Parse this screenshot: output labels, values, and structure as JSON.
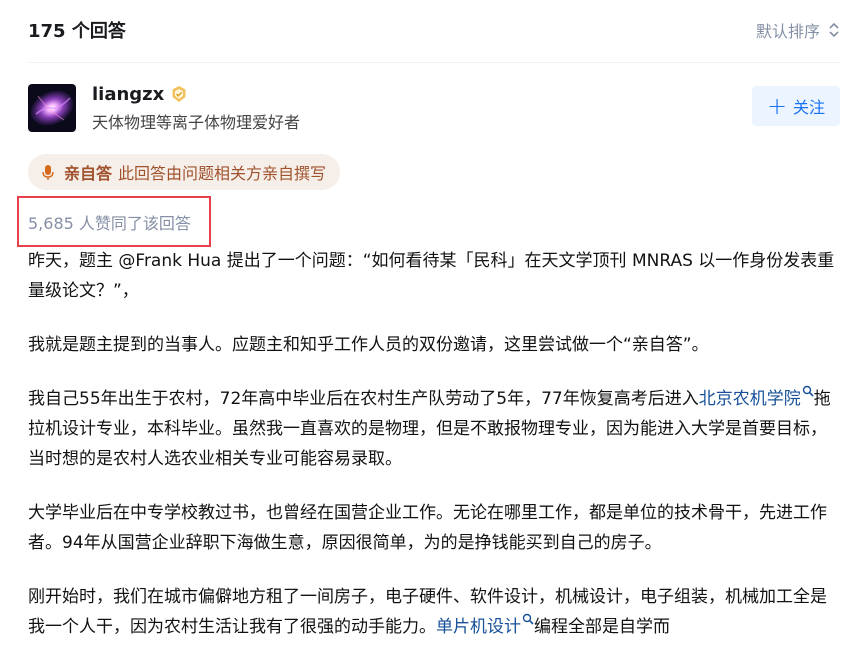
{
  "header": {
    "answer_count": "175 个回答",
    "sort_label": "默认排序"
  },
  "author": {
    "name": "liangzx",
    "bio": "天体物理等离子体物理爱好者",
    "follow_label": "关注"
  },
  "self_answer": {
    "title": "亲自答",
    "desc": "此回答由问题相关方亲自撰写"
  },
  "upvotes": {
    "text": "5,685 人赞同了该回答"
  },
  "content": {
    "p1": "昨天，题主 @Frank Hua 提出了一个问题：“如何看待某「民科」在天文学顶刊 MNRAS 以一作身份发表重量级论文？”，",
    "p2": "我就是题主提到的当事人。应题主和知乎工作人员的双份邀请，这里尝试做一个“亲自答”。",
    "p3_a": "我自己55年出生于农村，72年高中毕业后在农村生产队劳动了5年，77年恢复高考后进入",
    "p3_link": "北京农机学院",
    "p3_b": "拖拉机设计专业，本科毕业。虽然我一直喜欢的是物理，但是不敢报物理专业，因为能进入大学是首要目标，当时想的是农村人选农业相关专业可能容易录取。",
    "p4": "大学毕业后在中专学校教过书，也曾经在国营企业工作。无论在哪里工作，都是单位的技术骨干，先进工作者。94年从国营企业辞职下海做生意，原因很简单，为的是挣钱能买到自己的房子。",
    "p5_a": "刚开始时，我们在城市偏僻地方租了一间房子，电子硬件、软件设计，机械设计，电子组装，机械加工全是我一个人干，因为农村生活让我有了很强的动手能力。",
    "p5_link": "单片机设计",
    "p5_b": "编程全部是自学而"
  },
  "colors": {
    "link": "#175199",
    "accent": "#1772f6",
    "highlight_box": "#e8404b",
    "self_answer": "#a0522d"
  },
  "icons": [
    "sort-icon",
    "verified-badge-icon",
    "plus-icon",
    "mic-icon",
    "search-icon"
  ]
}
